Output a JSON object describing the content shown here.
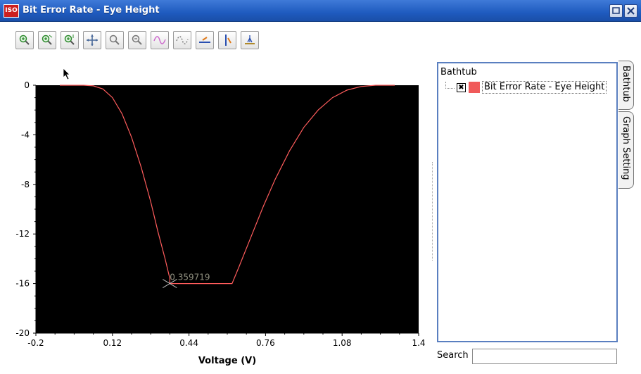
{
  "window": {
    "title": "Bit Error Rate - Eye Height",
    "app_icon_text": "ISO",
    "buttons": [
      "restore",
      "close"
    ]
  },
  "toolbar": {
    "tools": [
      "zoom-in-icon",
      "zoom-in-x-icon",
      "zoom-in-y-icon",
      "pan-icon",
      "zoom-box-icon",
      "zoom-out-icon",
      "curve-icon",
      "dotted-curve-icon",
      "horizontal-marker-icon",
      "vertical-marker-icon",
      "peak-marker-icon"
    ]
  },
  "chart_data": {
    "type": "line",
    "title": "",
    "xlabel": "Voltage (V)",
    "ylabel": "",
    "xlim": [
      -0.2,
      1.4
    ],
    "ylim": [
      -20,
      0
    ],
    "xticks": [
      "-0.2",
      "0.12",
      "0.44",
      "0.76",
      "1.08",
      "1.4"
    ],
    "xtick_values": [
      -0.2,
      0.12,
      0.44,
      0.76,
      1.08,
      1.4
    ],
    "yticks": [
      "0",
      "-4",
      "-8",
      "-12",
      "-16",
      "-20"
    ],
    "ytick_values": [
      0,
      -4,
      -8,
      -12,
      -16,
      -20
    ],
    "background": "#000000",
    "line_color": "#ff5c5c",
    "series": [
      {
        "x": [
          -0.1,
          0.0,
          0.04,
          0.08,
          0.12,
          0.16,
          0.2,
          0.24,
          0.28,
          0.31,
          0.34,
          0.36,
          0.3597,
          0.45,
          0.55,
          0.6,
          0.62,
          0.65,
          0.7,
          0.75,
          0.8,
          0.86,
          0.92,
          0.98,
          1.04,
          1.1,
          1.16,
          1.22,
          1.3
        ],
        "y": [
          0,
          0,
          -0.05,
          -0.3,
          -1.0,
          -2.3,
          -4.2,
          -6.6,
          -9.4,
          -11.8,
          -14.0,
          -15.6,
          -16,
          -16,
          -16,
          -16,
          -16,
          -14.6,
          -12.2,
          -9.8,
          -7.6,
          -5.3,
          -3.4,
          -2.0,
          -1.0,
          -0.4,
          -0.1,
          0,
          0
        ]
      }
    ],
    "marker": {
      "x": 0.359719,
      "y": -16,
      "label": "0.359719",
      "color": "#bdbdbd",
      "label_color": "#8f8f7f"
    }
  },
  "side_panel": {
    "header": "Bathtub",
    "items": [
      {
        "label": "Bit Error Rate - Eye Height",
        "checked": true,
        "color": "#f05a5a"
      }
    ],
    "tabs": [
      "Bathtub",
      "Graph Setting"
    ]
  },
  "search": {
    "label": "Search",
    "value": ""
  }
}
